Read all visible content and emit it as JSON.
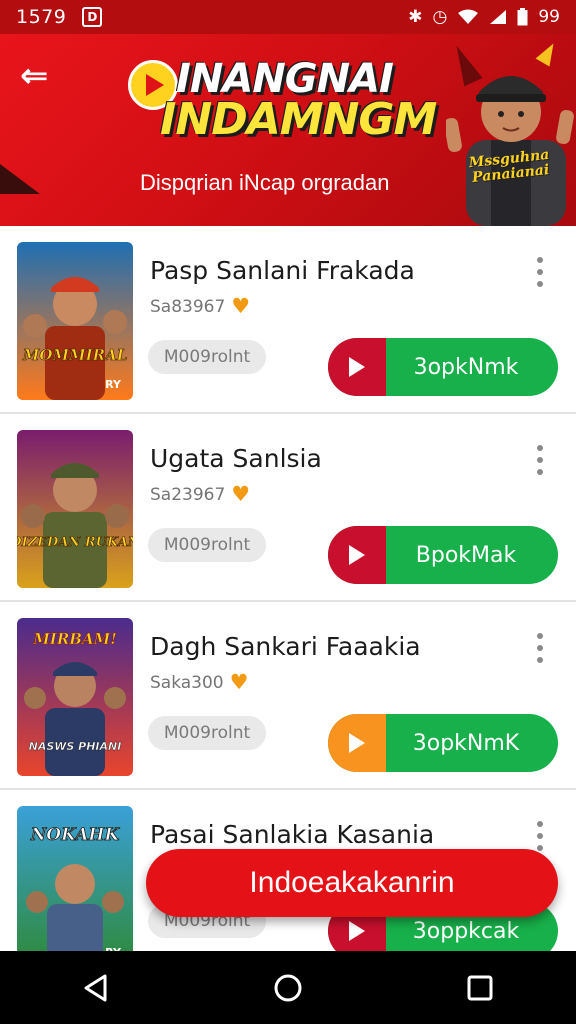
{
  "status_bar": {
    "time": "1579",
    "badge": "D",
    "battery_text": "99",
    "icons": [
      "bluetooth-icon",
      "alarm-icon",
      "wifi-icon",
      "signal-icon",
      "battery-icon"
    ]
  },
  "banner": {
    "title_line1": "INANGNAI",
    "title_line2": "INDAMNGM",
    "subtitle": "Dispqrian iNcap orgradan",
    "mascot_label": "Mssguhna Panaianai",
    "colors": {
      "background": "#e8151b",
      "title": "#ffe53b"
    }
  },
  "items": [
    {
      "title": "Pasp Sanlani Frakada",
      "meta": "Sa83967",
      "chip": "M009rolnt",
      "button": "3opkNmk",
      "poster_text": "MOMMIRAL",
      "poster_badge": "RY",
      "play_color": "#c8102e",
      "poster_colors": [
        "#1f6fb2",
        "#ff7a1a"
      ]
    },
    {
      "title": "Ugata Sanlsia",
      "meta": "Sa23967",
      "chip": "M009rolnt",
      "button": "BpokMak",
      "poster_text": "DIZEDAN RUKAN",
      "poster_badge": "",
      "play_color": "#c8102e",
      "poster_colors": [
        "#7a1c6e",
        "#d9a21b"
      ]
    },
    {
      "title": "Dagh Sankari Faaakia",
      "meta": "Saka300",
      "chip": "M009rolnt",
      "button": "3opkNmK",
      "poster_text": "NASWS PHIANI",
      "poster_badge": "",
      "play_color": "#f7931e",
      "poster_colors": [
        "#4a2b8c",
        "#e8452c"
      ]
    },
    {
      "title": "Pasai Sanlakia Kasania",
      "meta": "",
      "chip": "M009rolnt",
      "button": "3oppkcak",
      "poster_text": "NOKAHK",
      "poster_badge": "RY",
      "play_color": "#c8102e",
      "poster_colors": [
        "#3aa0d8",
        "#2f8a3a"
      ]
    }
  ],
  "fab": {
    "label": "Indoeakakanrin"
  },
  "nav": {
    "icons": [
      "back-triangle-icon",
      "home-circle-icon",
      "recents-square-icon"
    ]
  }
}
